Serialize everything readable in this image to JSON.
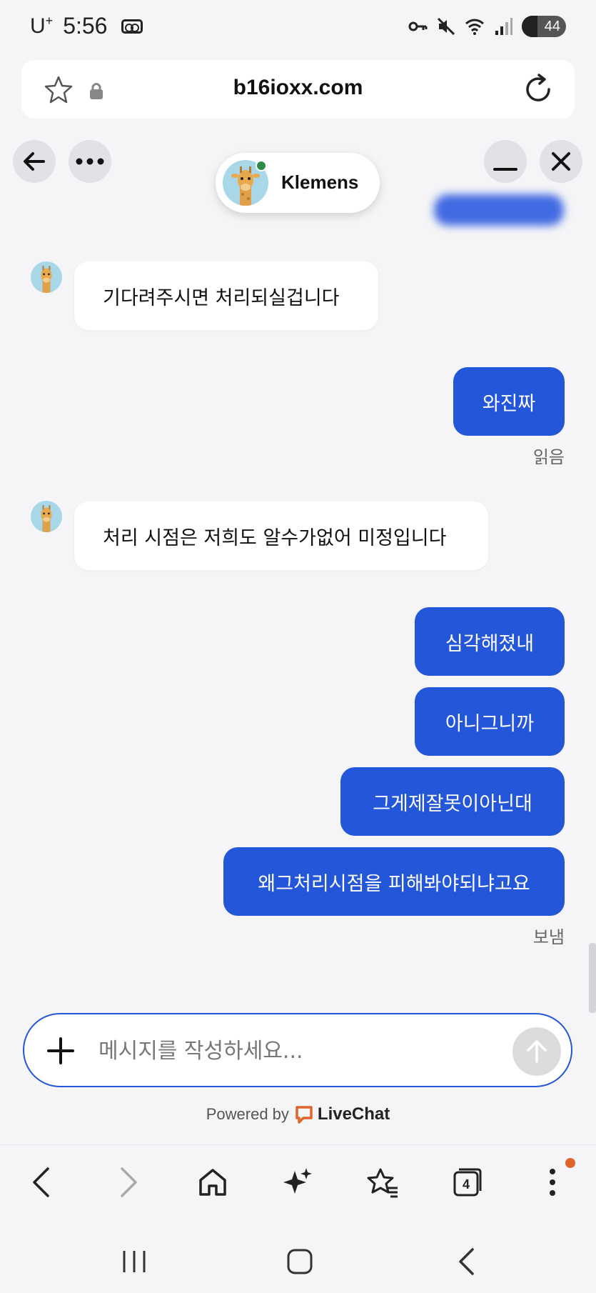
{
  "status_bar": {
    "carrier": "U",
    "carrier_sup": "+",
    "time": "5:56",
    "battery": "44"
  },
  "browser": {
    "url": "b16ioxx.com",
    "tab_count": "4"
  },
  "chat": {
    "agent_name": "Klemens",
    "messages": [
      {
        "direction": "in",
        "text": "기다려주시면 처리되실겁니다"
      },
      {
        "direction": "out",
        "text": "와진짜"
      },
      {
        "direction": "in",
        "text": "처리 시점은 저희도 알수가없어 미정입니다"
      },
      {
        "direction": "out",
        "text": "심각해졌내"
      },
      {
        "direction": "out",
        "text": "아니그니까"
      },
      {
        "direction": "out",
        "text": "그게제잘못이아닌대"
      },
      {
        "direction": "out",
        "text": "왜그처리시점을 피해봐야되냐고요"
      }
    ],
    "status_read": "읽음",
    "status_sent": "보냄",
    "composer_placeholder": "메시지를 작성하세요...",
    "powered_by": "Powered by",
    "brand": "LiveChat"
  },
  "colors": {
    "accent": "#2456d9",
    "online": "#2e8b4a",
    "notification": "#e0652a"
  }
}
